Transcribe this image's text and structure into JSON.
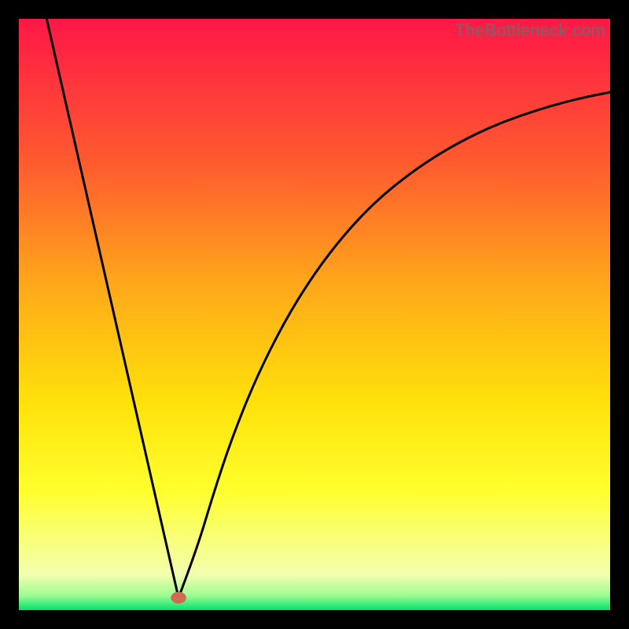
{
  "watermark": "TheBottleneck.com",
  "chart_data": {
    "type": "line",
    "title": "",
    "xlabel": "",
    "ylabel": "",
    "xlim": [
      0,
      100
    ],
    "ylim": [
      0,
      100
    ],
    "grid": false,
    "legend": false,
    "background_gradient": {
      "stops": [
        {
          "offset": 0.0,
          "color": "#ff1747"
        },
        {
          "offset": 0.25,
          "color": "#ff5d2e"
        },
        {
          "offset": 0.45,
          "color": "#ffa81a"
        },
        {
          "offset": 0.65,
          "color": "#ffe20a"
        },
        {
          "offset": 0.8,
          "color": "#ffff2e"
        },
        {
          "offset": 0.94,
          "color": "#f3ffb0"
        },
        {
          "offset": 0.975,
          "color": "#9efc92"
        },
        {
          "offset": 1.0,
          "color": "#00e36f"
        }
      ]
    },
    "marker": {
      "x": 27,
      "y": 2.1,
      "color": "#d16a55",
      "rx": 1.3,
      "ry": 1.0
    },
    "series": [
      {
        "name": "left",
        "x": [
          4.7,
          27
        ],
        "y": [
          100,
          2.1
        ]
      },
      {
        "name": "right",
        "x": [
          27,
          30,
          33,
          36,
          40,
          45,
          50,
          55,
          60,
          65,
          70,
          75,
          80,
          85,
          90,
          95,
          100
        ],
        "y": [
          2.1,
          10,
          20,
          29,
          39,
          49,
          57,
          63.5,
          68.8,
          73,
          76.5,
          79.4,
          81.8,
          83.7,
          85.3,
          86.6,
          87.6
        ]
      }
    ]
  }
}
